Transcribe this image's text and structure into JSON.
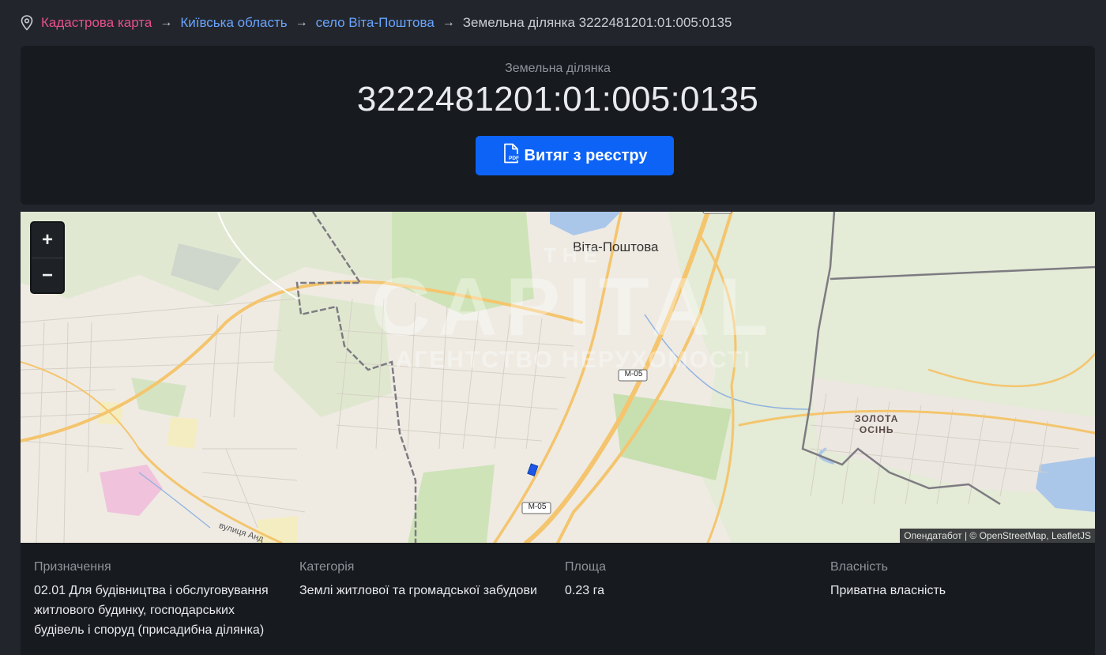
{
  "breadcrumb": {
    "icon": "map-pin-icon",
    "items": [
      {
        "label": "Кадастрова карта",
        "type": "home"
      },
      {
        "label": "Київська область",
        "type": "link"
      },
      {
        "label": "село Віта-Поштова",
        "type": "link"
      },
      {
        "label": "Земельна ділянка 3222481201:01:005:0135",
        "type": "current"
      }
    ]
  },
  "header": {
    "subtitle": "Земельна ділянка",
    "title": "3222481201:01:005:0135",
    "pdf_button": {
      "label": "Витяг з реєстру",
      "icon": "pdf-file-icon",
      "color": "#0d63f5"
    }
  },
  "map": {
    "zoom_in": "+",
    "zoom_out": "−",
    "labels": {
      "town": "Віта-Поштова",
      "village_line1": "ЗОЛОТА",
      "village_line2": "ОСІНЬ",
      "road1": "М-05",
      "road2": "М-05",
      "street": "вулиця Анд",
      "street_prefix": ""
    },
    "watermark": {
      "line1": "THE",
      "line2": "CAPITAL",
      "line3": "АГЕНТСТВО НЕРУХОМОСТІ"
    },
    "attribution": "Опендатабот | © OpenStreetMap, LeafletJS"
  },
  "details": [
    {
      "label": "Призначення",
      "value": "02.01 Для будівництва і обслуговування житлового будинку, господарських будівель і споруд (присадибна ділянка)"
    },
    {
      "label": "Категорія",
      "value": "Землі житлової та громадської забудови"
    },
    {
      "label": "Площа",
      "value": "0.23 га"
    },
    {
      "label": "Власність",
      "value": "Приватна власність"
    }
  ]
}
